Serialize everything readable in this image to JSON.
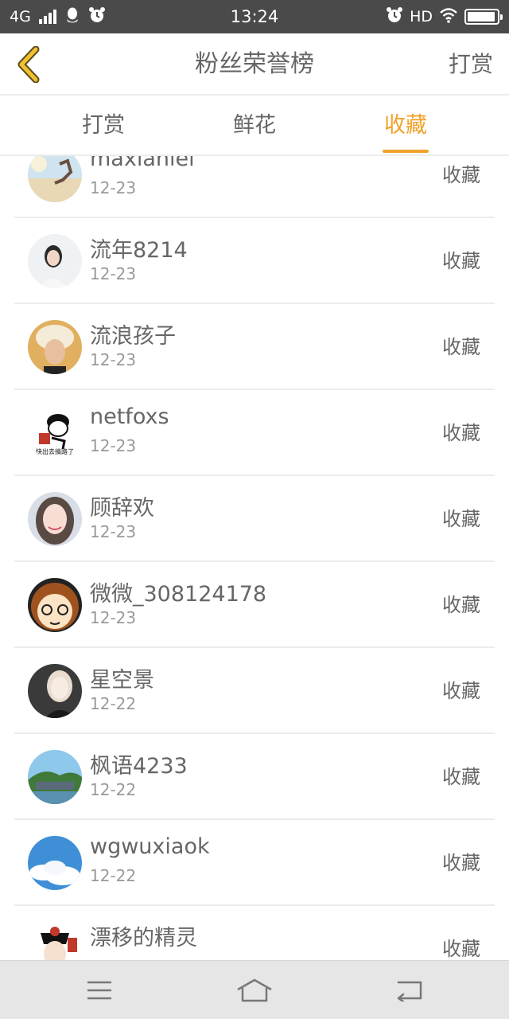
{
  "status_bar": {
    "network": "4G",
    "time": "13:24",
    "hd": "HD",
    "battery_level": 0.95,
    "icons": [
      "signal-icon",
      "qq-icon",
      "alarm-icon",
      "wifi-icon",
      "battery-icon"
    ]
  },
  "nav": {
    "back_icon": "chevron-left-icon",
    "title": "粉丝荣誉榜",
    "action_label": "打赏"
  },
  "tabs": [
    {
      "label": "打赏",
      "active": false
    },
    {
      "label": "鲜花",
      "active": false
    },
    {
      "label": "收藏",
      "active": true
    }
  ],
  "colors": {
    "accent": "#f0a22a",
    "status_bar": "#4a4a4a",
    "text": "#666666",
    "subtext": "#999999",
    "bottom_nav": "#e6e6e6"
  },
  "list": [
    {
      "name": "maxianlei",
      "date": "12-23",
      "action": "收藏"
    },
    {
      "name": "流年8214",
      "date": "12-23",
      "action": "收藏"
    },
    {
      "name": "流浪孩子",
      "date": "12-23",
      "action": "收藏"
    },
    {
      "name": "netfoxs",
      "date": "12-23",
      "action": "收藏",
      "avatar_caption": "快出去搞路了"
    },
    {
      "name": "顾辞欢",
      "date": "12-23",
      "action": "收藏"
    },
    {
      "name": "微微_308124178",
      "date": "12-23",
      "action": "收藏"
    },
    {
      "name": "星空景",
      "date": "12-22",
      "action": "收藏"
    },
    {
      "name": "枫语4233",
      "date": "12-22",
      "action": "收藏"
    },
    {
      "name": "wgwuxiaok",
      "date": "12-22",
      "action": "收藏"
    },
    {
      "name": "漂移的精灵",
      "date": "",
      "action": "收藏"
    }
  ],
  "bottom_nav": {
    "icons": [
      "menu-icon",
      "home-icon",
      "back-icon"
    ]
  }
}
